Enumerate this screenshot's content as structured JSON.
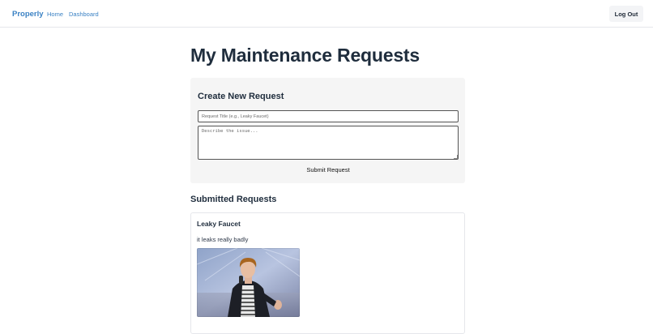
{
  "header": {
    "brand": "Properly",
    "nav": [
      {
        "label": "Home"
      },
      {
        "label": "Dashboard"
      }
    ],
    "logout_label": "Log Out"
  },
  "main": {
    "title": "My Maintenance Requests",
    "create": {
      "heading": "Create New Request",
      "title_placeholder": "Request Title (e.g., Leaky Faucet)",
      "title_value": "",
      "description_placeholder": "Describe the issue...",
      "description_value": "",
      "submit_label": "Submit Request"
    },
    "submitted_heading": "Submitted Requests",
    "requests": [
      {
        "title": "Leaky Faucet",
        "description": "it leaks really badly",
        "photo": "photo of a man in a dark coat singing into a microphone"
      }
    ]
  },
  "colors": {
    "brand": "#3b82c4",
    "heading": "#1f2d3d",
    "card_bg": "#f5f5f5",
    "border": "#e5e7eb"
  }
}
